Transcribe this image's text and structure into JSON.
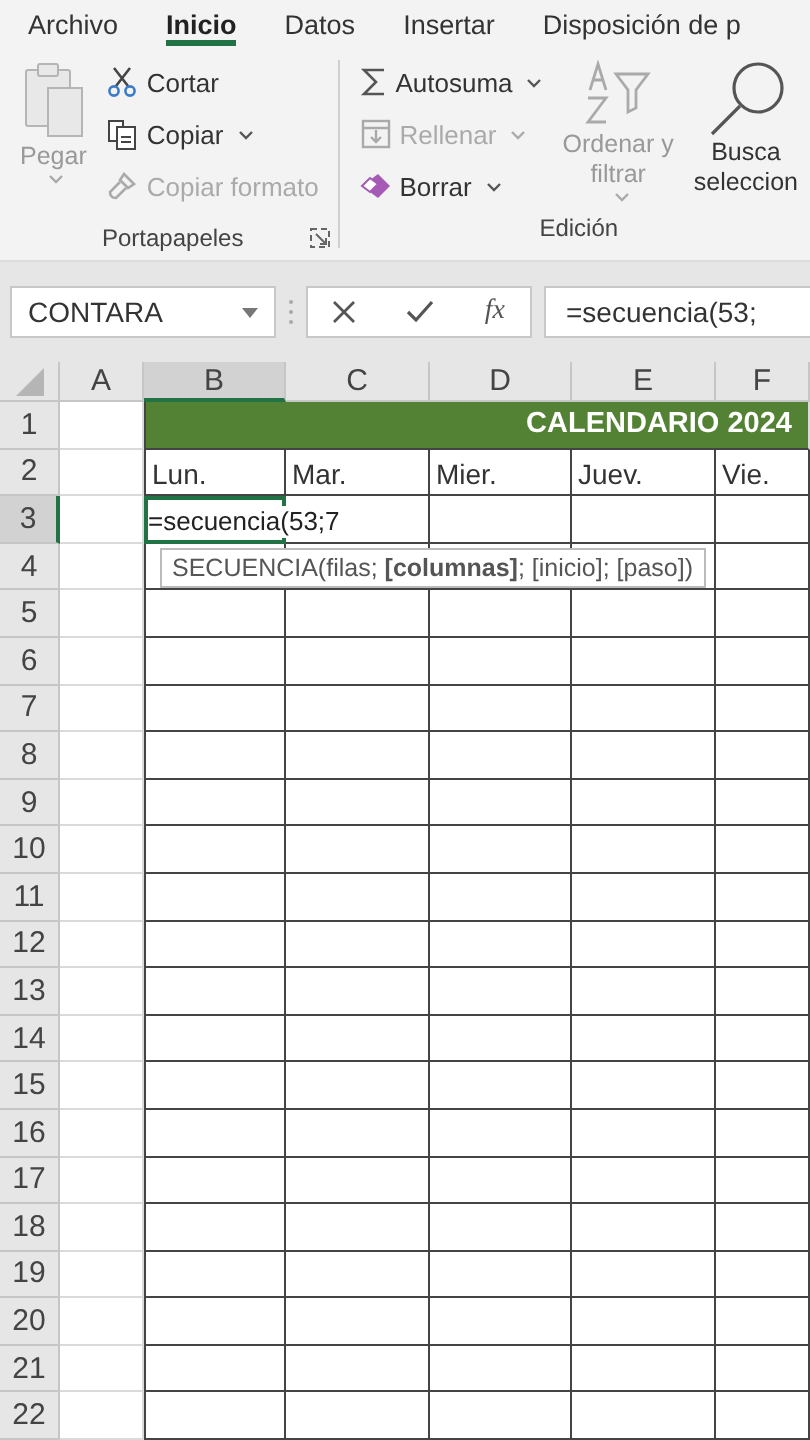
{
  "ribbon_tabs": [
    {
      "label": "Archivo",
      "selected": false
    },
    {
      "label": "Inicio",
      "selected": true
    },
    {
      "label": "Datos",
      "selected": false
    },
    {
      "label": "Insertar",
      "selected": false
    },
    {
      "label": "Disposición de p",
      "selected": false
    }
  ],
  "ribbon_groups": [
    {
      "title": "Portapapeles",
      "launcher": true,
      "items": [
        {
          "kind": "large",
          "lines": [
            "Pegar"
          ],
          "disabled": true,
          "dropdown": true
        },
        {
          "kind": "small",
          "label": "Cortar",
          "disabled": false,
          "dropdown": false
        },
        {
          "kind": "small",
          "label": "Copiar",
          "disabled": false,
          "dropdown": true
        },
        {
          "kind": "small",
          "label": "Copiar formato",
          "disabled": true,
          "dropdown": false
        }
      ]
    },
    {
      "title": "Edición",
      "launcher": false,
      "items": [
        {
          "kind": "small",
          "label": "Autosuma",
          "disabled": false,
          "dropdown": true
        },
        {
          "kind": "small",
          "label": "Rellenar",
          "disabled": true,
          "dropdown": true
        },
        {
          "kind": "small",
          "label": "Borrar",
          "disabled": false,
          "dropdown": true
        },
        {
          "kind": "large",
          "lines": [
            "Ordenar y",
            "filtrar"
          ],
          "disabled": true,
          "dropdown": true
        },
        {
          "kind": "large",
          "lines": [
            "Busca",
            "seleccion"
          ],
          "disabled": false,
          "dropdown": false
        }
      ]
    }
  ],
  "formula_bar": {
    "name_box": "CONTARA",
    "function_button": "fx",
    "formula": "=secuencia(53;"
  },
  "sheet": {
    "columns": [
      {
        "label": "A",
        "selected": false
      },
      {
        "label": "B",
        "selected": true
      },
      {
        "label": "C",
        "selected": false
      },
      {
        "label": "D",
        "selected": false
      },
      {
        "label": "E",
        "selected": false
      },
      {
        "label": "F",
        "selected": false
      }
    ],
    "row_headers": [
      {
        "label": "1",
        "selected": false
      },
      {
        "label": "2",
        "selected": false
      },
      {
        "label": "3",
        "selected": true
      },
      {
        "label": "4",
        "selected": false
      },
      {
        "label": "5",
        "selected": false
      },
      {
        "label": "6",
        "selected": false
      },
      {
        "label": "7",
        "selected": false
      },
      {
        "label": "8",
        "selected": false
      },
      {
        "label": "9",
        "selected": false
      },
      {
        "label": "10",
        "selected": false
      },
      {
        "label": "11",
        "selected": false
      },
      {
        "label": "12",
        "selected": false
      },
      {
        "label": "13",
        "selected": false
      },
      {
        "label": "14",
        "selected": false
      },
      {
        "label": "15",
        "selected": false
      },
      {
        "label": "16",
        "selected": false
      },
      {
        "label": "17",
        "selected": false
      },
      {
        "label": "18",
        "selected": false
      },
      {
        "label": "19",
        "selected": false
      },
      {
        "label": "20",
        "selected": false
      },
      {
        "label": "21",
        "selected": false
      },
      {
        "label": "22",
        "selected": false
      }
    ],
    "title_banner": "CALENDARIO 2024",
    "weekday_headers": [
      "Lun.",
      "Mar.",
      "Mier.",
      "Juev.",
      "Vie."
    ],
    "editing_cell": "=secuencia(53;7",
    "function_tooltip": "SECUENCIA(filas; **[columnas]**; [inicio]; [paso])"
  }
}
